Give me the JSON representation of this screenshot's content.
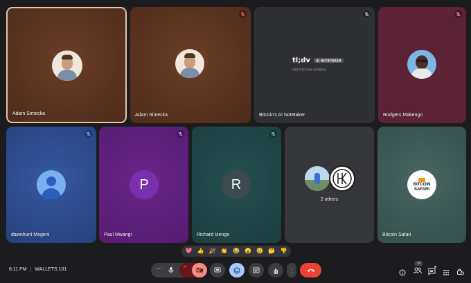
{
  "participants": [
    {
      "name": "Adam Simecka",
      "color": "#5a3220"
    },
    {
      "name": "Adam Simecka",
      "color": "#5a3220"
    },
    {
      "name": "Bitcoin's AI Notetaker",
      "color": "#2f3034"
    },
    {
      "name": "Rodgers Makengo",
      "color": "#5c2236"
    },
    {
      "name": "dawnhunt Mogeni",
      "color": "#2c4a86"
    },
    {
      "name": "Paul Mwangi",
      "color": "#5c1e79"
    },
    {
      "name": "Richard Izengo",
      "color": "#1f4547"
    },
    {
      "name": "Bitcoin Safari",
      "color": "#3d5653"
    }
  ],
  "notetaker": {
    "logo": "tl;dv",
    "badge": "AI NOTETAKER",
    "tagline": "Get it for free at tldv.io"
  },
  "avatars": {
    "paul": "P",
    "richard": "R",
    "bitcoin_safari_line1": "BITCOIN",
    "bitcoin_safari_line2": "SAFARI"
  },
  "others": {
    "label": "2 others"
  },
  "reactions": [
    "💖",
    "👍",
    "🎉",
    "👏",
    "😂",
    "😮",
    "😢",
    "🤔",
    "👎"
  ],
  "bottom": {
    "time": "8:11 PM",
    "separator": "|",
    "meeting": "WALLETS 101",
    "people_count": "10"
  },
  "icons": {
    "more": "more-icon",
    "mic": "mic-icon",
    "chevron": "chevron-up-icon",
    "camera": "camera-off-icon",
    "present": "present-icon",
    "emoji": "emoji-icon",
    "captions": "captions-icon",
    "hand": "raise-hand-icon",
    "overflow": "more-vertical-icon",
    "hangup": "hangup-icon",
    "info": "info-icon",
    "people": "people-icon",
    "chat": "chat-icon",
    "activities": "activities-icon",
    "lock": "host-controls-icon"
  }
}
